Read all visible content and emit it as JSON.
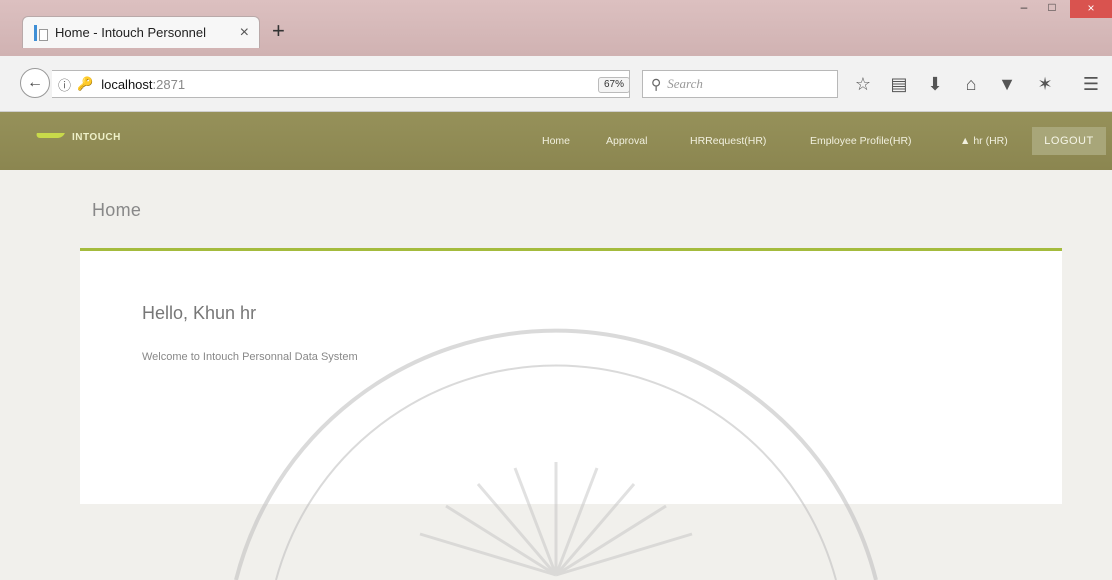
{
  "browser": {
    "tab": {
      "title": "Home - Intouch Personnel",
      "close_glyph": "×"
    },
    "new_tab_glyph": "+",
    "window_controls": {
      "minimize": "–",
      "maximize": "□",
      "close": "×"
    },
    "address": {
      "host": "localhost",
      "port": ":2871",
      "zoom": "67%"
    },
    "search": {
      "placeholder": "Search"
    },
    "toolbar_icons": [
      "star-icon",
      "reading-list-icon",
      "download-icon",
      "home-icon",
      "pocket-icon",
      "extension-icon",
      "menu-icon"
    ]
  },
  "app": {
    "logo_text": "INTOUCH",
    "nav": {
      "home": "Home",
      "approval": "Approval",
      "hr_request": "HRRequest(HR)",
      "employee_profile": "Employee Profile(HR)",
      "user": "hr (HR)",
      "logout": "LOGOUT"
    },
    "page_title": "Home",
    "greeting": "Hello, Khun hr",
    "welcome_message": "Welcome to Intouch Personnal Data System"
  },
  "colors": {
    "header": "#8e8953",
    "accent": "#a4bb3d",
    "logout_bg": "#a8a679",
    "tab_strip": "#d6baba"
  }
}
